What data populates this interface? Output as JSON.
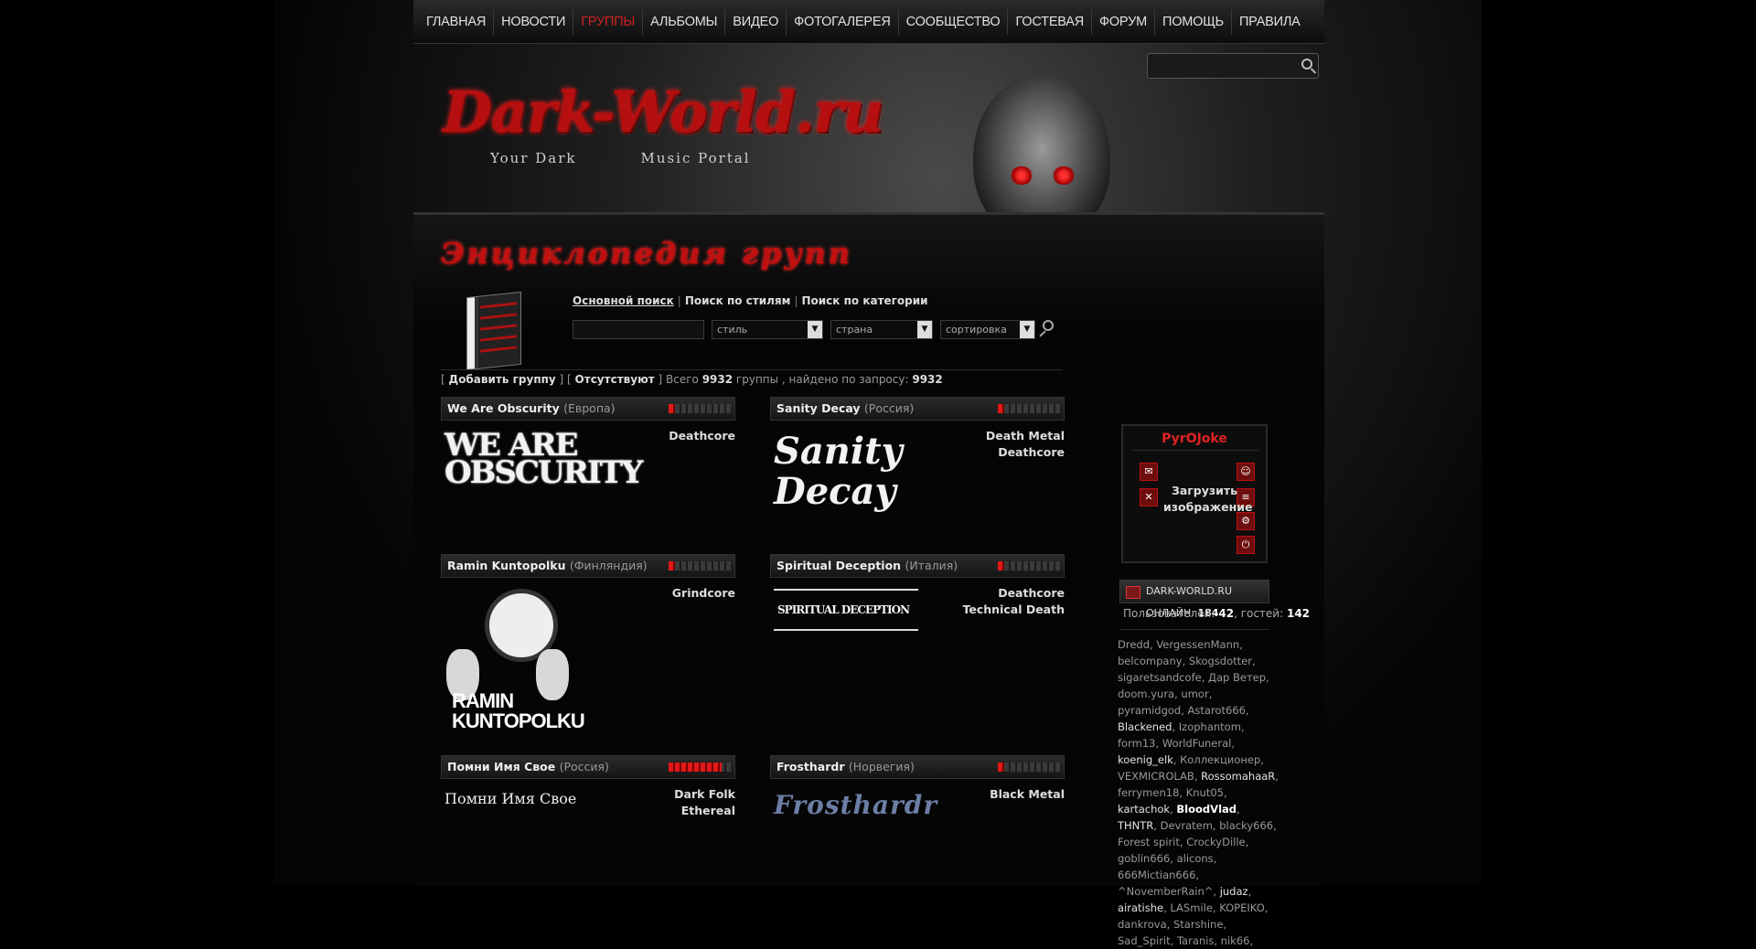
{
  "nav": {
    "items": [
      {
        "label": "ГЛАВНАЯ",
        "active": false
      },
      {
        "label": "НОВОСТИ",
        "active": false
      },
      {
        "label": "ГРУППЫ",
        "active": true
      },
      {
        "label": "АЛЬБОМЫ",
        "active": false
      },
      {
        "label": "ВИДЕО",
        "active": false
      },
      {
        "label": "ФОТОГАЛЕРЕЯ",
        "active": false
      },
      {
        "label": "СООБЩЕСТВО",
        "active": false
      },
      {
        "label": "ГОСТЕВАЯ",
        "active": false
      },
      {
        "label": "ФОРУМ",
        "active": false
      },
      {
        "label": "ПОМОЩЬ",
        "active": false
      },
      {
        "label": "ПРАВИЛА",
        "active": false
      }
    ]
  },
  "header": {
    "logo": "Dark-World.ru",
    "tagline_left": "Your Dark",
    "tagline_right": "Music Portal"
  },
  "section": {
    "title": "Энциклопедия групп"
  },
  "search": {
    "tab_basic": "Основной поиск",
    "tab_styles": "Поиск по стилям",
    "tab_category": "Поиск по категории",
    "select_style": "стиль",
    "select_country": "страна",
    "select_sort": "сортировка"
  },
  "stats": {
    "add_group": "Добавить группу",
    "missing": "Отсутствуют",
    "total_label": "Всего",
    "total": "9932",
    "groups_word": "группы , найдено по запросу:",
    "found": "9932"
  },
  "bands": [
    {
      "name": "We Are Obscurity",
      "country": "(Европа)",
      "genres": [
        "Deathcore"
      ],
      "rating": 0.1,
      "logo_text": "WE ARE OBSCURITY"
    },
    {
      "name": "Sanity Decay",
      "country": "(Россия)",
      "genres": [
        "Death Metal",
        "Deathcore"
      ],
      "rating": 0.1,
      "logo_text": "Sanity Decay"
    },
    {
      "name": "Ramin Kuntopolku",
      "country": "(Финляндия)",
      "genres": [
        "Grindcore"
      ],
      "rating": 0.1,
      "logo_text": "RAMIN KUNTOPOLKU"
    },
    {
      "name": "Spiritual Deception",
      "country": "(Италия)",
      "genres": [
        "Deathcore",
        "Technical Death"
      ],
      "rating": 0.1,
      "logo_text": "SPIRITUAL DECEPTION"
    },
    {
      "name": "Помни Имя Свое",
      "country": "(Россия)",
      "genres": [
        "Dark Folk",
        "Ethereal"
      ],
      "rating": 0.85,
      "logo_text": "Помни Имя Свое"
    },
    {
      "name": "Frosthardr",
      "country": "(Норвегия)",
      "genres": [
        "Black Metal"
      ],
      "rating": 0.1,
      "logo_text": "Frosthardr"
    }
  ],
  "user_panel": {
    "username": "PyrOJoke",
    "upload_label": "Загрузить изображение"
  },
  "online": {
    "label": "DARK-WORLD.RU ОНЛАЙН:",
    "count": "184",
    "users_label": "Пользователей:",
    "users": "42",
    "guests_label": ", гостей:",
    "guests": "142"
  },
  "online_users": [
    {
      "name": "Dredd",
      "style": ""
    },
    {
      "name": "VergessenMann",
      "style": ""
    },
    {
      "name": "belcompany",
      "style": ""
    },
    {
      "name": "Skogsdotter",
      "style": ""
    },
    {
      "name": "sigaretsandcofe",
      "style": ""
    },
    {
      "name": "Дар Ветер",
      "style": ""
    },
    {
      "name": "doom.yura",
      "style": ""
    },
    {
      "name": "umor",
      "style": ""
    },
    {
      "name": "pyramidgod",
      "style": ""
    },
    {
      "name": "Astarot666",
      "style": ""
    },
    {
      "name": "Blackened",
      "style": "hl"
    },
    {
      "name": "Izophantom",
      "style": ""
    },
    {
      "name": "form13",
      "style": ""
    },
    {
      "name": "WorldFuneral",
      "style": ""
    },
    {
      "name": "koenig_elk",
      "style": "hl"
    },
    {
      "name": "Коллекционер",
      "style": ""
    },
    {
      "name": "VEXMICROLAB",
      "style": ""
    },
    {
      "name": "RossomahaaR",
      "style": "hl"
    },
    {
      "name": "ferrymen18",
      "style": ""
    },
    {
      "name": "Knut05",
      "style": ""
    },
    {
      "name": "kartachok",
      "style": "hl"
    },
    {
      "name": "BloodVlad",
      "style": "hb"
    },
    {
      "name": "THNTR",
      "style": "hl"
    },
    {
      "name": "Devratem",
      "style": ""
    },
    {
      "name": "blacky666",
      "style": ""
    },
    {
      "name": "Forest spirit",
      "style": ""
    },
    {
      "name": "CrockyDille",
      "style": ""
    },
    {
      "name": "goblin666",
      "style": ""
    },
    {
      "name": "alicons",
      "style": ""
    },
    {
      "name": "666Mictian666",
      "style": ""
    },
    {
      "name": "^NovemberRain^",
      "style": ""
    },
    {
      "name": "judaz",
      "style": "hl"
    },
    {
      "name": "airatishe",
      "style": "hl"
    },
    {
      "name": "LASmile",
      "style": ""
    },
    {
      "name": "KOPEIKO",
      "style": ""
    },
    {
      "name": "dankrova",
      "style": ""
    },
    {
      "name": "Starshine",
      "style": ""
    },
    {
      "name": "Sad_Spirit",
      "style": ""
    },
    {
      "name": "Taranis",
      "style": ""
    },
    {
      "name": "nik66",
      "style": ""
    }
  ],
  "colors": {
    "accent": "#d12020",
    "background": "#000000"
  }
}
